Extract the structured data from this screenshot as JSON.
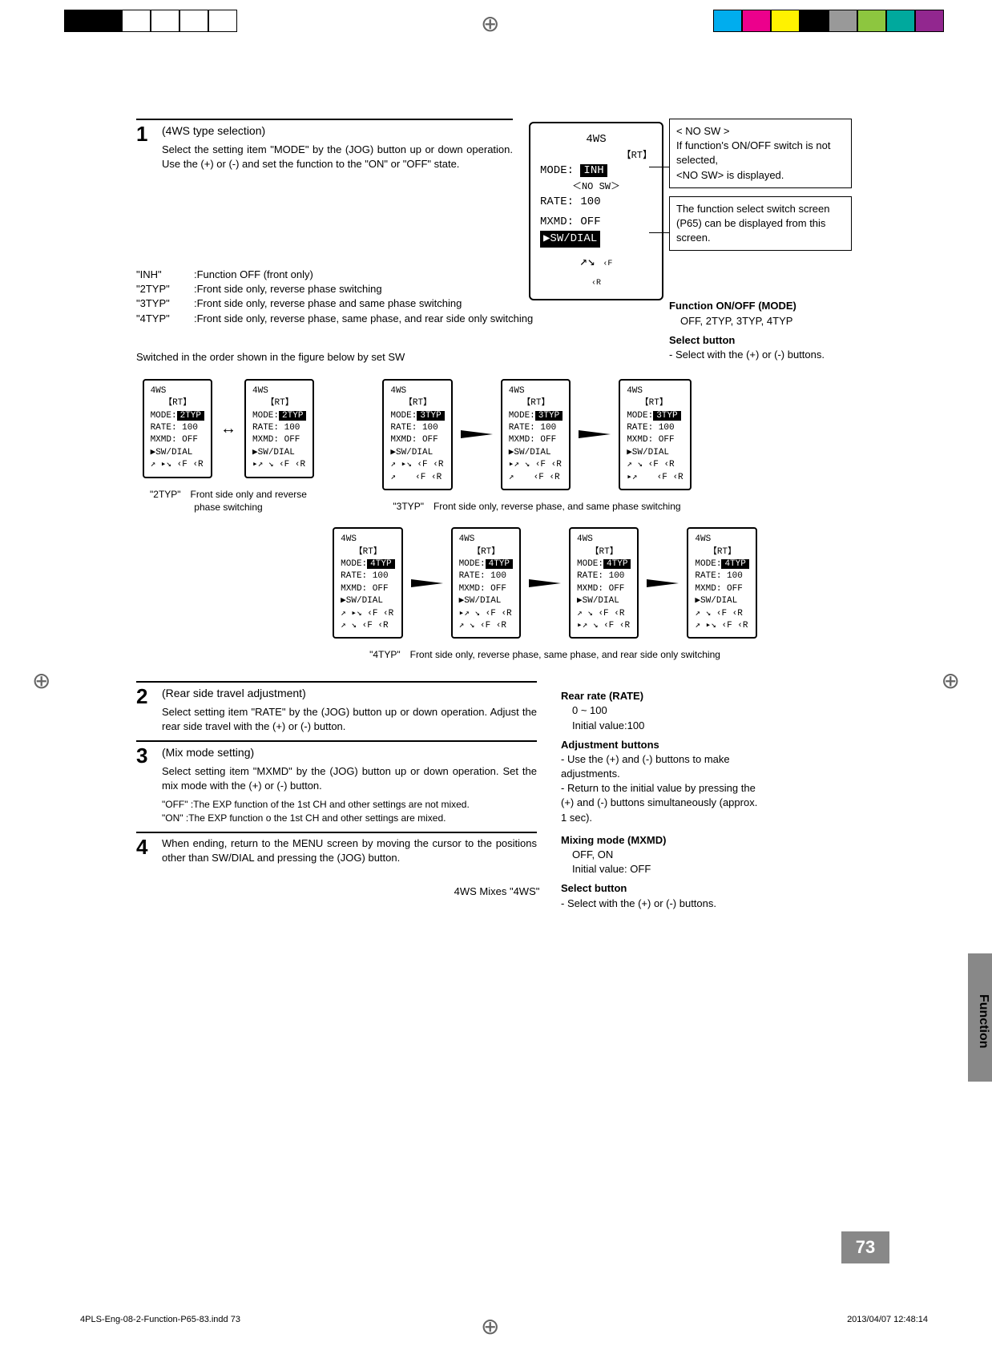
{
  "regbar": {
    "left_colors": [
      "#000",
      "#000",
      "#fff",
      "#fff",
      "#fff",
      "#fff"
    ],
    "right_colors": [
      "#00adee",
      "#ec008c",
      "#fff200",
      "#000",
      "#999",
      "#8dc63f",
      "#00a99d",
      "#92278f"
    ]
  },
  "step1": {
    "num": "1",
    "title": "(4WS type selection)",
    "text": "Select the setting item \"MODE\" by the (JOG) button up or down operation. Use the (+) or (-) and set the function to the \"ON\" or \"OFF\" state."
  },
  "lcd_main": {
    "header": "4WS",
    "rt": "【RT】",
    "mode_label": "MODE:",
    "mode_value": "INH",
    "nosw": "＜NO SW＞",
    "rate": "RATE: 100",
    "mxmd": "MXMD: OFF",
    "swdial": "▶SW/DIAL",
    "icons": "⬈ ⬊ ‹F ‹R"
  },
  "sidebox_nosw": {
    "title": "< NO SW >",
    "line1": "If function's ON/OFF switch is not selected,",
    "line2": "<NO SW> is displayed."
  },
  "sidebox_func": {
    "line1": "The function select switch screen (P65) can be displayed from this screen."
  },
  "types": [
    {
      "k": "\"INH\"",
      "v": ":Function OFF (front only)"
    },
    {
      "k": "\"2TYP\"",
      "v": ":Front side only, reverse phase switching"
    },
    {
      "k": "\"3TYP\"",
      "v": ":Front side only, reverse phase and same phase switching"
    },
    {
      "k": "\"4TYP\"",
      "v": ":Front side only, reverse phase, same phase, and rear side only switching"
    }
  ],
  "side_mode": {
    "hd": "Function ON/OFF (MODE)",
    "line": "OFF, 2TYP, 3TYP, 4TYP",
    "sel_hd": "Select button",
    "sel_line": "- Select with the (+) or (-) buttons."
  },
  "switched_line": "Switched in the order shown in the figure below by set SW",
  "fig_small": {
    "mode2": "2TYP",
    "mode3": "3TYP",
    "mode4": "4TYP",
    "rate": "RATE: 100",
    "mxmd": "MXMD: OFF",
    "swdial": "▶SW/DIAL"
  },
  "cap_2typ": "\"2TYP\"　Front side only and reverse phase switching",
  "cap_3typ": "\"3TYP\"　Front side only, reverse phase, and same phase switching",
  "cap_4typ": "\"4TYP\"　Front side only, reverse phase, same phase, and rear side only switching",
  "step2": {
    "num": "2",
    "title": "(Rear side travel adjustment)",
    "text": "Select setting item \"RATE\" by the (JOG) button up or down operation.  Adjust the rear side travel with the (+) or (-) button."
  },
  "side_rate": {
    "hd": "Rear rate (RATE)",
    "range": "0 ~ 100",
    "init": "Initial value:100",
    "adj_hd": "Adjustment buttons",
    "adj1": "- Use the (+) and (-) buttons to make adjustments.",
    "adj2": "- Return to the initial value by pressing the (+) and (-) buttons simultaneously (approx. 1 sec)."
  },
  "step3": {
    "num": "3",
    "title": "(Mix mode setting)",
    "text": "Select setting item \"MXMD\"  by the (JOG) button up or down operation. Set the mix mode with the (+) or (-) button.",
    "off": "\"OFF\"   :The EXP function of the 1st CH and other settings are not mixed.",
    "on": "\"ON\"    :The EXP function o the 1st CH and other settings are mixed."
  },
  "side_mxmd": {
    "hd": "Mixing mode (MXMD)",
    "vals": "OFF, ON",
    "init": "Initial value: OFF",
    "sel_hd": "Select button",
    "sel_line": "- Select with the (+) or (-) buttons."
  },
  "step4": {
    "num": "4",
    "text": "When ending, return to the MENU screen by moving the cursor to the positions other than SW/DIAL and pressing the (JOG) button."
  },
  "footer_title": "4WS Mixes \"4WS\"",
  "side_tab": "Function",
  "page_num": "73",
  "meta_left": "4PLS-Eng-08-2-Function-P65-83.indd   73",
  "meta_right": "2013/04/07   12:48:14"
}
